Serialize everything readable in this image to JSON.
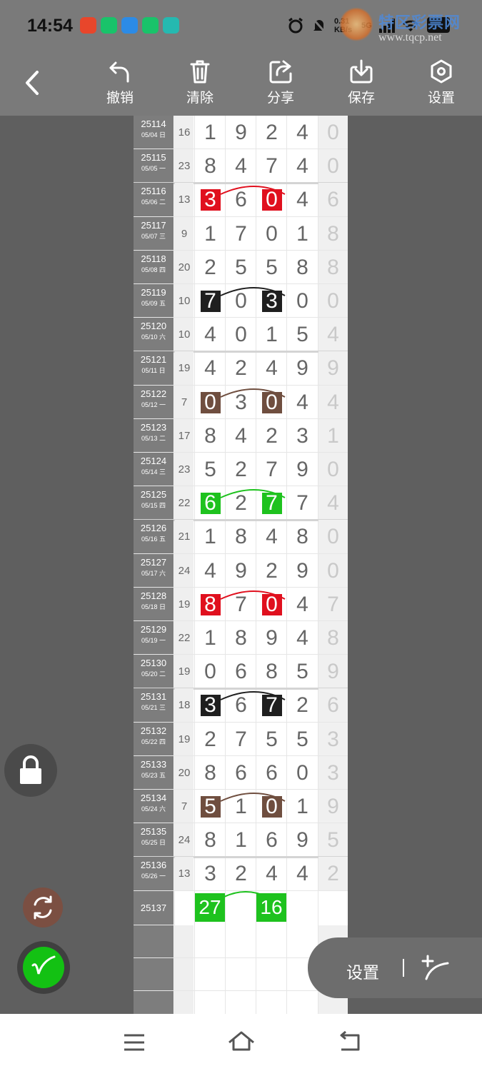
{
  "status": {
    "time": "14:54",
    "net_speed": "0.31 KB/s",
    "signal": "5G"
  },
  "watermark": {
    "title": "特区彩票网",
    "url": "www.tqcp.net"
  },
  "toolbar": {
    "undo": "撤销",
    "clear": "清除",
    "share": "分享",
    "save": "保存",
    "settings": "设置"
  },
  "rows": [
    {
      "id": "25114",
      "date": "05/04 日",
      "sum": "16",
      "d": [
        "1",
        "9",
        "2",
        "4"
      ],
      "last": "0"
    },
    {
      "id": "25115",
      "date": "05/05 一",
      "sum": "23",
      "d": [
        "8",
        "4",
        "7",
        "4"
      ],
      "last": "0"
    },
    {
      "id": "25116",
      "date": "05/06 二",
      "sum": "13",
      "d": [
        "3",
        "6",
        "0",
        "4"
      ],
      "last": "6"
    },
    {
      "id": "25117",
      "date": "05/07 三",
      "sum": "9",
      "d": [
        "1",
        "7",
        "0",
        "1"
      ],
      "last": "8"
    },
    {
      "id": "25118",
      "date": "05/08 四",
      "sum": "20",
      "d": [
        "2",
        "5",
        "5",
        "8"
      ],
      "last": "8"
    },
    {
      "id": "25119",
      "date": "05/09 五",
      "sum": "10",
      "d": [
        "7",
        "0",
        "3",
        "0"
      ],
      "last": "0"
    },
    {
      "id": "25120",
      "date": "05/10 六",
      "sum": "10",
      "d": [
        "4",
        "0",
        "1",
        "5"
      ],
      "last": "4"
    },
    {
      "id": "25121",
      "date": "05/11 日",
      "sum": "19",
      "d": [
        "4",
        "2",
        "4",
        "9"
      ],
      "last": "9"
    },
    {
      "id": "25122",
      "date": "05/12 一",
      "sum": "7",
      "d": [
        "0",
        "3",
        "0",
        "4"
      ],
      "last": "4"
    },
    {
      "id": "25123",
      "date": "05/13 二",
      "sum": "17",
      "d": [
        "8",
        "4",
        "2",
        "3"
      ],
      "last": "1"
    },
    {
      "id": "25124",
      "date": "05/14 三",
      "sum": "23",
      "d": [
        "5",
        "2",
        "7",
        "9"
      ],
      "last": "0"
    },
    {
      "id": "25125",
      "date": "05/15 四",
      "sum": "22",
      "d": [
        "6",
        "2",
        "7",
        "7"
      ],
      "last": "4"
    },
    {
      "id": "25126",
      "date": "05/16 五",
      "sum": "21",
      "d": [
        "1",
        "8",
        "4",
        "8"
      ],
      "last": "0"
    },
    {
      "id": "25127",
      "date": "05/17 六",
      "sum": "24",
      "d": [
        "4",
        "9",
        "2",
        "9"
      ],
      "last": "0"
    },
    {
      "id": "25128",
      "date": "05/18 日",
      "sum": "19",
      "d": [
        "8",
        "7",
        "0",
        "4"
      ],
      "last": "7"
    },
    {
      "id": "25129",
      "date": "05/19 一",
      "sum": "22",
      "d": [
        "1",
        "8",
        "9",
        "4"
      ],
      "last": "8"
    },
    {
      "id": "25130",
      "date": "05/20 二",
      "sum": "19",
      "d": [
        "0",
        "6",
        "8",
        "5"
      ],
      "last": "9"
    },
    {
      "id": "25131",
      "date": "05/21 三",
      "sum": "18",
      "d": [
        "3",
        "6",
        "7",
        "2"
      ],
      "last": "6"
    },
    {
      "id": "25132",
      "date": "05/22 四",
      "sum": "19",
      "d": [
        "2",
        "7",
        "5",
        "5"
      ],
      "last": "3"
    },
    {
      "id": "25133",
      "date": "05/23 五",
      "sum": "20",
      "d": [
        "8",
        "6",
        "6",
        "0"
      ],
      "last": "3"
    },
    {
      "id": "25134",
      "date": "05/24 六",
      "sum": "7",
      "d": [
        "5",
        "1",
        "0",
        "1"
      ],
      "last": "9"
    },
    {
      "id": "25135",
      "date": "05/25 日",
      "sum": "24",
      "d": [
        "8",
        "1",
        "6",
        "9"
      ],
      "last": "5"
    },
    {
      "id": "25136",
      "date": "05/26 一",
      "sum": "13",
      "d": [
        "3",
        "2",
        "4",
        "4"
      ],
      "last": "2"
    }
  ],
  "highlights": [
    {
      "row": 2,
      "color": "#e0101e"
    },
    {
      "row": 5,
      "color": "#1f1f1f"
    },
    {
      "row": 8,
      "color": "#6f4e3f"
    },
    {
      "row": 11,
      "color": "#1ec21e"
    },
    {
      "row": 14,
      "color": "#e0101e"
    },
    {
      "row": 17,
      "color": "#1f1f1f"
    },
    {
      "row": 20,
      "color": "#6f4e3f"
    }
  ],
  "prediction": {
    "id": "25137",
    "left": "27",
    "right": "16",
    "color": "#1ec21e"
  },
  "pill": {
    "label": "设置"
  }
}
